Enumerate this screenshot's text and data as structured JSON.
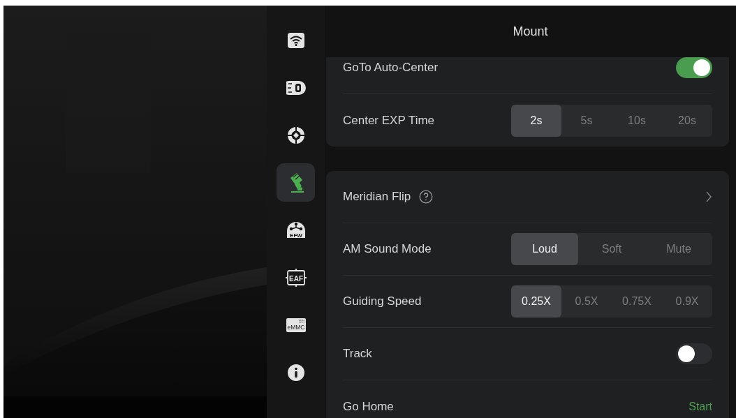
{
  "sidebar": {
    "items": [
      {
        "kind": "wifi",
        "selected": false
      },
      {
        "kind": "camera",
        "selected": false
      },
      {
        "kind": "target",
        "selected": false
      },
      {
        "kind": "mount",
        "selected": true
      },
      {
        "kind": "efw",
        "label": "EFW",
        "selected": false
      },
      {
        "kind": "eaf",
        "label": "EAF",
        "selected": false
      },
      {
        "kind": "emmc",
        "label": "eMMC",
        "selected": false
      },
      {
        "kind": "info",
        "selected": false
      }
    ]
  },
  "header": {
    "title": "Mount"
  },
  "cards": [
    {
      "rows": [
        {
          "kind": "toggle",
          "label": "GoTo Auto-Center",
          "on": true
        },
        {
          "kind": "segmented",
          "label": "Center EXP Time",
          "options": [
            {
              "label": "2s",
              "selected": true
            },
            {
              "label": "5s",
              "selected": false
            },
            {
              "label": "10s",
              "selected": false
            },
            {
              "label": "20s",
              "selected": false
            }
          ]
        }
      ]
    },
    {
      "rows": [
        {
          "kind": "link",
          "label": "Meridian Flip",
          "help": true
        },
        {
          "kind": "segmented",
          "label": "AM Sound Mode",
          "options": [
            {
              "label": "Loud",
              "selected": true
            },
            {
              "label": "Soft",
              "selected": false
            },
            {
              "label": "Mute",
              "selected": false
            }
          ]
        },
        {
          "kind": "segmented",
          "label": "Guiding Speed",
          "options": [
            {
              "label": "0.25X",
              "selected": true
            },
            {
              "label": "0.5X",
              "selected": false
            },
            {
              "label": "0.75X",
              "selected": false
            },
            {
              "label": "0.9X",
              "selected": false
            }
          ]
        },
        {
          "kind": "toggle",
          "label": "Track",
          "on": false
        },
        {
          "kind": "action",
          "label": "Go Home",
          "action": "Start"
        }
      ]
    }
  ]
}
